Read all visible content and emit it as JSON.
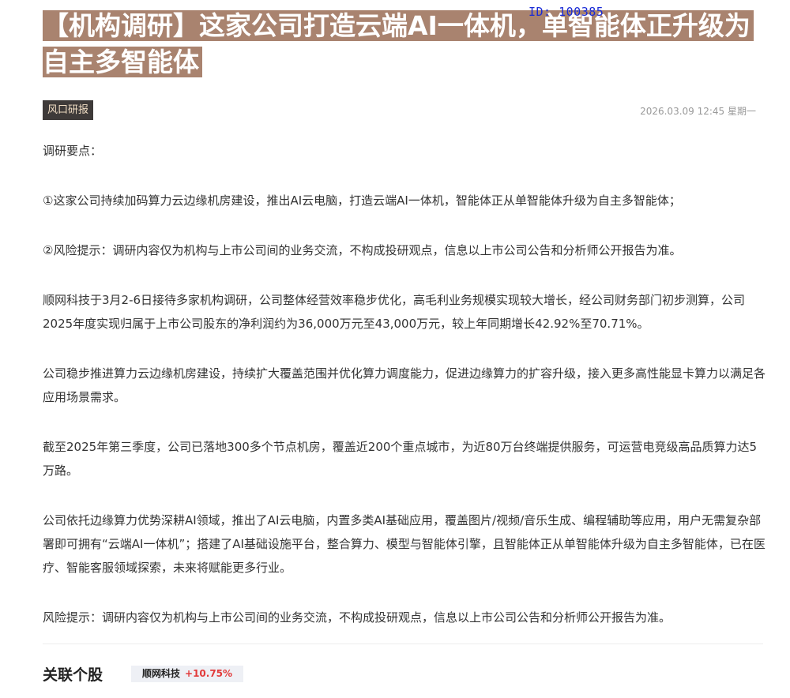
{
  "watermark": "ID: 100385",
  "article": {
    "title": "【机构调研】这家公司打造云端AI一体机，单智能体正升级为自主多智能体",
    "tag": "风口研报",
    "datetime": "2026.03.09 12:45 星期一",
    "paragraphs": [
      "调研要点：",
      "①这家公司持续加码算力云边缘机房建设，推出AI云电脑，打造云端AI一体机，智能体正从单智能体升级为自主多智能体；",
      "②风险提示：调研内容仅为机构与上市公司间的业务交流，不构成投研观点，信息以上市公司公告和分析师公开报告为准。",
      "顺网科技于3月2-6日接待多家机构调研，公司整体经营效率稳步优化，高毛利业务规模实现较大增长，经公司财务部门初步测算，公司2025年度实现归属于上市公司股东的净利润约为36,000万元至43,000万元，较上年同期增长42.92%至70.71%。",
      "公司稳步推进算力云边缘机房建设，持续扩大覆盖范围并优化算力调度能力，促进边缘算力的扩容升级，接入更多高性能显卡算力以满足各应用场景需求。",
      "截至2025年第三季度，公司已落地300多个节点机房，覆盖近200个重点城市，为近80万台终端提供服务，可运营电竞级高品质算力达5万路。",
      "公司依托边缘算力优势深耕AI领域，推出了AI云电脑，内置多类AI基础应用，覆盖图片/视频/音乐生成、编程辅助等应用，用户无需复杂部署即可拥有“云端AI一体机”；搭建了AI基础设施平台，整合算力、模型与智能体引擎，且智能体正从单智能体升级为自主多智能体，已在医疗、智能客服领域探索，未来将赋能更多行业。",
      "风险提示：调研内容仅为机构与上市公司间的业务交流，不构成投研观点，信息以上市公司公告和分析师公开报告为准。"
    ]
  },
  "related": {
    "heading": "关联个股",
    "stocks": [
      {
        "name": "顺网科技",
        "change": "+10.75%"
      }
    ]
  },
  "colors": {
    "title_highlight": "#a9836f",
    "tag_bg": "#3e3a39",
    "tag_text": "#f0ddc4",
    "stock_up": "#e23a3a",
    "watermark": "#1a2bd6"
  }
}
